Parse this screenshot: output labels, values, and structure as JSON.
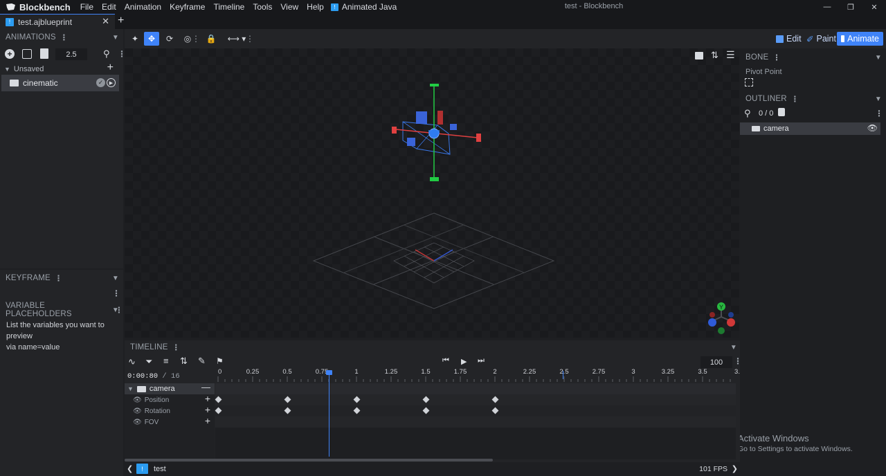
{
  "titlebar": {
    "app_name": "Blockbench",
    "menu": [
      "File",
      "Edit",
      "Animation",
      "Keyframe",
      "Timeline",
      "Tools",
      "View",
      "Help"
    ],
    "plugin_menu": "Animated Java",
    "window_title": "test - Blockbench"
  },
  "tab": {
    "label": "test.ajblueprint"
  },
  "animations": {
    "header": "ANIMATIONS",
    "length_value": "2.5",
    "group_label": "Unsaved",
    "items": [
      {
        "label": "cinematic"
      }
    ]
  },
  "keyframe_panel": {
    "header": "KEYFRAME"
  },
  "variables_panel": {
    "header": "VARIABLE PLACEHOLDERS",
    "help_line1": "List the variables you want to preview",
    "help_line2": "via name=value"
  },
  "modes": {
    "edit": "Edit",
    "paint": "Paint",
    "animate": "Animate"
  },
  "bone_panel": {
    "header": "BONE",
    "pivot_label": "Pivot Point"
  },
  "outliner": {
    "header": "OUTLINER",
    "count": "0 / 0",
    "items": [
      {
        "label": "camera"
      }
    ]
  },
  "timeline": {
    "header": "TIMELINE",
    "zoom_value": "100",
    "time_display": "0:00:80",
    "time_total": "/ 16",
    "ticks": [
      "0",
      "0.25",
      "0.5",
      "0.75",
      "1",
      "1.25",
      "1.5",
      "1.75",
      "2",
      "2.25",
      "2.5",
      "2.75",
      "3",
      "3.25",
      "3.5",
      "3."
    ],
    "playhead_time": 0.8,
    "animator": {
      "label": "camera"
    },
    "channels": [
      {
        "label": "Position",
        "keyframes": [
          0,
          0.5,
          1,
          1.5,
          2
        ]
      },
      {
        "label": "Rotation",
        "keyframes": [
          0,
          0.5,
          1,
          1.5,
          2
        ]
      },
      {
        "label": "FOV",
        "keyframes": []
      }
    ]
  },
  "statusbar": {
    "project": "test",
    "fps": "101 FPS"
  },
  "watermark": {
    "line1": "Activate Windows",
    "line2": "Go to Settings to activate Windows."
  },
  "colors": {
    "accent": "#3f83f8",
    "panel": "#232427",
    "background": "#1e1f22",
    "axis_x": "#e04040",
    "axis_y": "#22cc44",
    "axis_z": "#3366ee"
  }
}
